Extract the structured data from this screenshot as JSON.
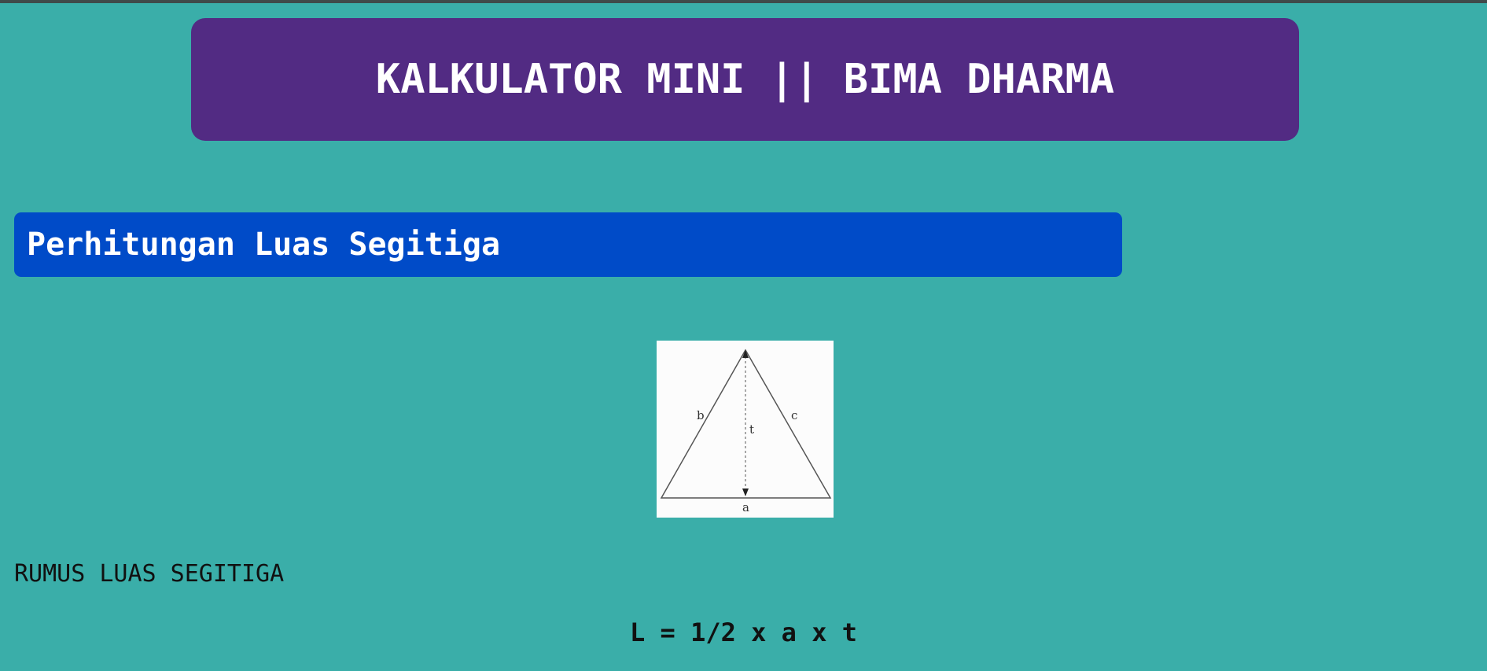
{
  "header": {
    "title": "KALKULATOR MINI || BIMA DHARMA"
  },
  "section": {
    "title": "Perhitungan Luas Segitiga"
  },
  "diagram": {
    "label_b": "b",
    "label_c": "c",
    "label_t": "t",
    "label_a": "a"
  },
  "rumus": {
    "label": "RUMUS LUAS SEGITIGA",
    "formula": "L = 1/2 x a x t"
  },
  "colors": {
    "background": "#3aaea9",
    "header": "#522b83",
    "section_bar": "#004bc8"
  }
}
